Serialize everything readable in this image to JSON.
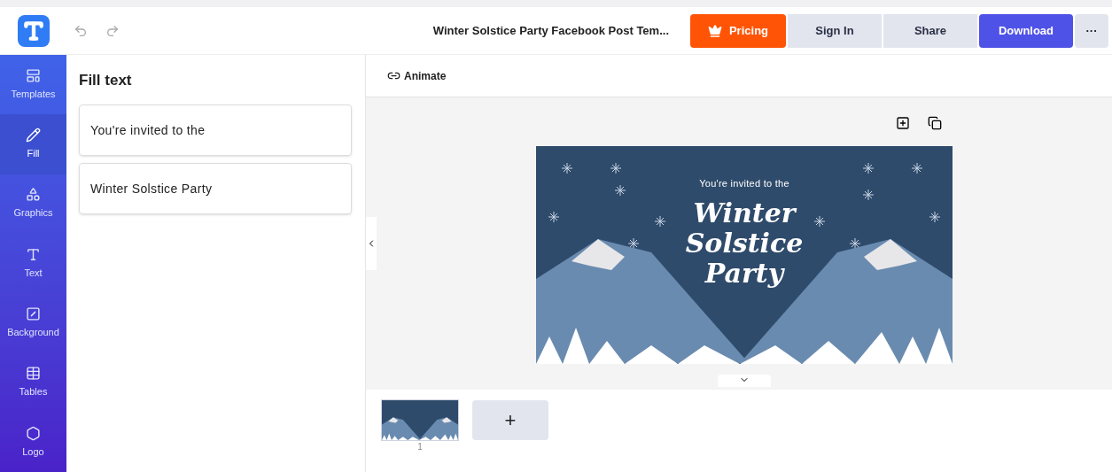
{
  "header": {
    "document_title": "Winter Solstice Party Facebook Post Tem...",
    "buttons": [
      {
        "kind": "pricing",
        "label": "Pricing"
      },
      {
        "kind": "plain",
        "label": "Sign In"
      },
      {
        "kind": "plain",
        "label": "Share"
      },
      {
        "kind": "primary",
        "label": "Download"
      },
      {
        "kind": "more",
        "label": "···"
      }
    ]
  },
  "sidebar": {
    "items": [
      {
        "label": "Templates",
        "selected": false
      },
      {
        "label": "Fill",
        "selected": true
      },
      {
        "label": "Graphics",
        "selected": false
      },
      {
        "label": "Text",
        "selected": false
      },
      {
        "label": "Background",
        "selected": false
      },
      {
        "label": "Tables",
        "selected": false
      },
      {
        "label": "Logo",
        "selected": false
      }
    ]
  },
  "panel": {
    "title": "Fill text",
    "fields": [
      "You're invited to the",
      "Winter Solstice Party"
    ]
  },
  "toolbar": {
    "animate_label": "Animate"
  },
  "design": {
    "subtitle": "You're invited to the",
    "title_lines": [
      "Winter",
      "Solstice",
      "Party"
    ]
  },
  "pages": [
    {
      "number": "1",
      "selected": true
    }
  ],
  "add_page_label": "+"
}
